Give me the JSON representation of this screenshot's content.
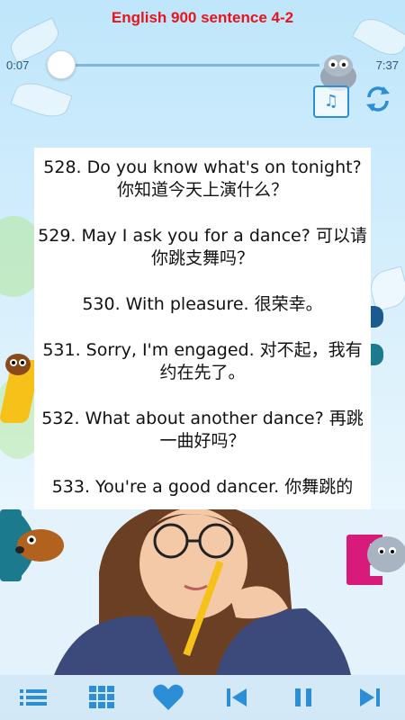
{
  "header": {
    "title": "English 900 sentence 4-2"
  },
  "player": {
    "elapsed": "0:07",
    "duration": "7:37",
    "progress": 0.015
  },
  "sentences": [
    {
      "en": "528. Do you know what's on tonight?",
      "zh": "你知道今天上演什么？"
    },
    {
      "en": "529. May I ask you for a dance?",
      "zh": "可以请你跳支舞吗？"
    },
    {
      "en": "530. With pleasure.",
      "zh": "很荣幸。"
    },
    {
      "en": "531. Sorry, I'm engaged.",
      "zh": "对不起，我有约在先了。"
    },
    {
      "en": "532. What about another dance?",
      "zh": "再跳一曲好吗？"
    },
    {
      "en": "533. You're a good dancer.",
      "zh": "你舞跳的"
    }
  ],
  "toolbar": {
    "icons": [
      "list-icon",
      "grid-icon",
      "heart-icon",
      "skip-previous-icon",
      "pause-icon",
      "skip-next-icon"
    ],
    "accent": "#2b8ed6"
  },
  "colors": {
    "title": "#e8141c",
    "accent": "#2b8ed6"
  }
}
